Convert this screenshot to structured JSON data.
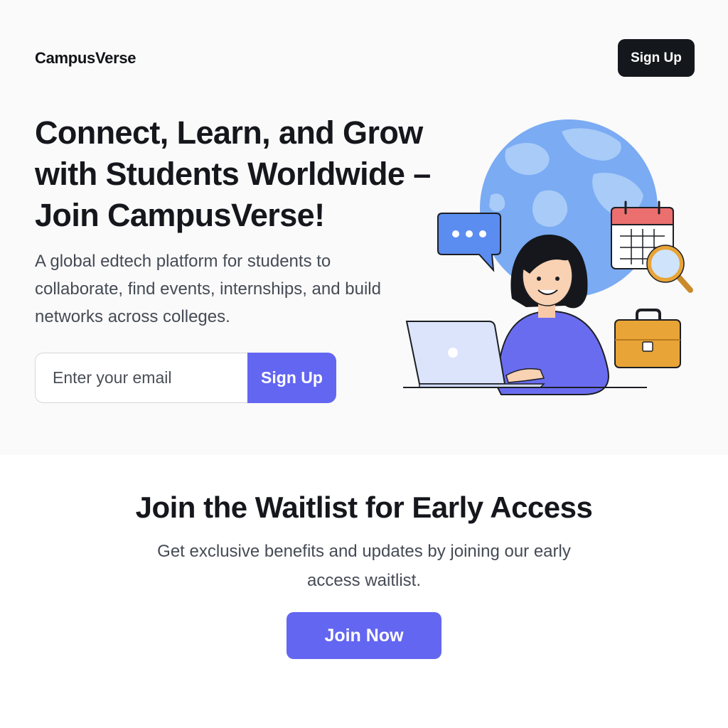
{
  "header": {
    "brand": "CampusVerse",
    "signup_label": "Sign Up"
  },
  "hero": {
    "headline": "Connect, Learn, and Grow with Students Worldwide – Join CampusVerse!",
    "subtext": "A global edtech platform for students to collaborate, find events, internships, and build networks across colleges.",
    "email_placeholder": "Enter your email",
    "signup_label": "Sign Up"
  },
  "illustration": {
    "icons": [
      "globe-icon",
      "chat-bubble-icon",
      "calendar-icon",
      "magnifier-icon",
      "briefcase-icon",
      "laptop-icon",
      "student-avatar"
    ]
  },
  "waitlist": {
    "title": "Join the Waitlist for Early Access",
    "subtext": "Get exclusive benefits and updates by joining our early access waitlist.",
    "button_label": "Join Now"
  },
  "colors": {
    "accent": "#6366f1",
    "dark_button": "#14171b",
    "hero_bg": "#fafafa",
    "globe": "#6ea2f0",
    "calendar_header": "#ec6f6f",
    "briefcase": "#e8a436"
  }
}
